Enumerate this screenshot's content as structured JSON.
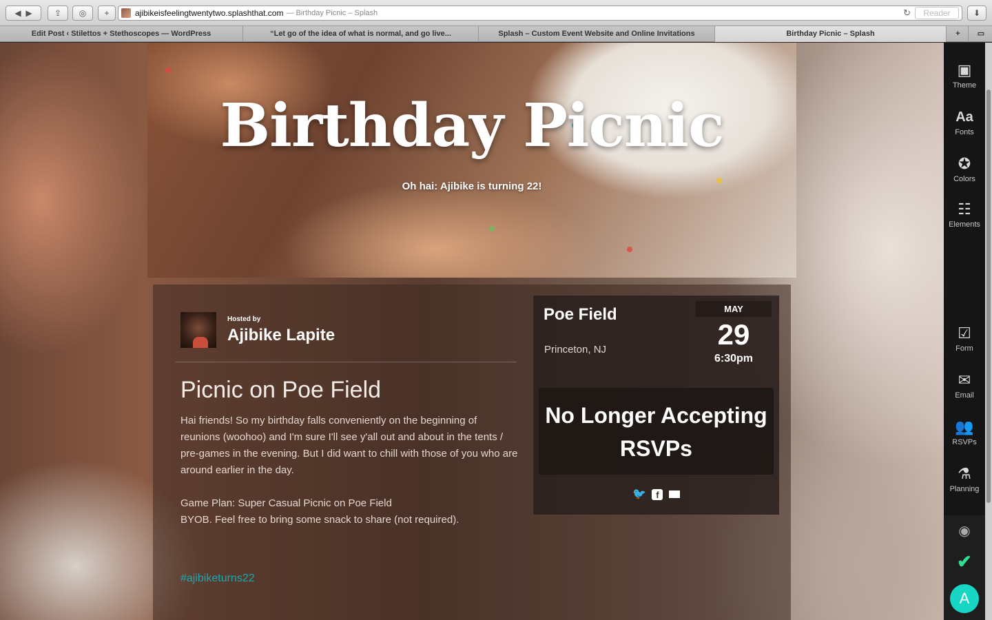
{
  "browser": {
    "url_host": "ajibikeisfeelingtwentytwo.splashthat.com",
    "url_title": "— Birthday Picnic – Splash",
    "reader_label": "Reader",
    "tabs": [
      {
        "label": "Edit Post ‹ Stilettos + Stethoscopes — WordPress"
      },
      {
        "label": "“Let go of the idea of what is normal, and go live..."
      },
      {
        "label": "Splash – Custom Event Website and Online Invitations"
      },
      {
        "label": "Birthday Picnic – Splash"
      }
    ]
  },
  "hero": {
    "title": "Birthday Picnic",
    "subtitle": "Oh hai: Ajibike is turning 22!"
  },
  "host": {
    "hosted_by": "Hosted by",
    "name": "Ajibike Lapite"
  },
  "description": {
    "title": "Picnic on Poe Field",
    "paragraph1": "Hai friends! So my birthday falls conveniently on the beginning of reunions  (woohoo)  and I'm sure I'll see y'all out and about in the tents / pre-games in the evening. But I did want to chill with those of you who are around earlier in the day.",
    "line_game_plan": "Game Plan: Super Casual Picnic on Poe Field",
    "line_byob": "BYOB. Feel free to bring some snack to share (not required).",
    "hashtag": "#ajibiketurns22"
  },
  "event": {
    "venue": "Poe Field",
    "city": "Princeton, NJ",
    "month": "MAY",
    "day": "29",
    "time": "6:30pm",
    "rsvp_status": "No Longer Accepting RSVPs"
  },
  "share": {
    "icons": [
      "twitter-icon",
      "facebook-icon",
      "email-icon"
    ]
  },
  "sidebar": {
    "items": [
      {
        "label": "Theme",
        "icon": "image-icon"
      },
      {
        "label": "Fonts",
        "icon": "fonts-icon"
      },
      {
        "label": "Colors",
        "icon": "palette-icon"
      },
      {
        "label": "Elements",
        "icon": "grid-icon"
      },
      {
        "label": "Form",
        "icon": "checkbox-icon"
      },
      {
        "label": "Email",
        "icon": "envelope-icon"
      },
      {
        "label": "RSVPs",
        "icon": "users-icon"
      },
      {
        "label": "Planning",
        "icon": "flask-icon"
      }
    ],
    "user_initial": "A",
    "accent": "#18d6c4",
    "check_color": "#2ee08f"
  }
}
